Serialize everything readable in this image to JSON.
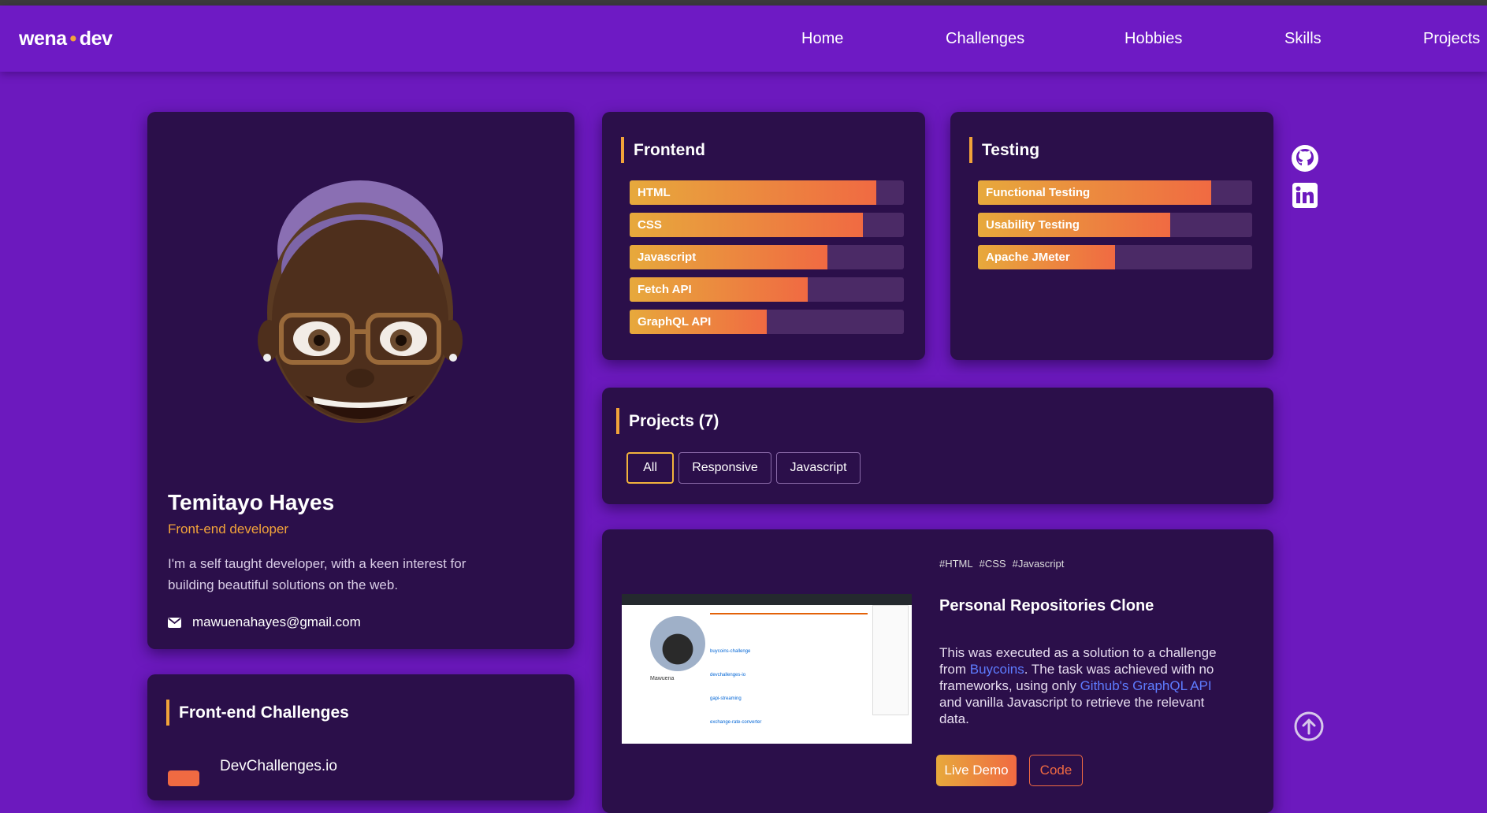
{
  "nav": {
    "brand_left": "wena",
    "brand_dot": "•",
    "brand_right": "dev",
    "links": [
      "Home",
      "Challenges",
      "Hobbies",
      "Skills",
      "Projects"
    ]
  },
  "profile": {
    "name": "Temitayo Hayes",
    "role": "Front-end developer",
    "bio": "I'm a self taught developer, with a keen interest for building beautiful solutions on the web.",
    "email": "mawuenahayes@gmail.com"
  },
  "frontend": {
    "title": "Frontend",
    "skills": [
      {
        "label": "HTML",
        "level": 0.9
      },
      {
        "label": "CSS",
        "level": 0.85
      },
      {
        "label": "Javascript",
        "level": 0.72
      },
      {
        "label": "Fetch API",
        "level": 0.65
      },
      {
        "label": "GraphQL API",
        "level": 0.5
      }
    ]
  },
  "testing": {
    "title": "Testing",
    "skills": [
      {
        "label": "Functional Testing",
        "level": 0.85
      },
      {
        "label": "Usability Testing",
        "level": 0.7
      },
      {
        "label": "Apache JMeter",
        "level": 0.5
      }
    ]
  },
  "projects": {
    "title": "Projects (7)",
    "filters": [
      "All",
      "Responsive",
      "Javascript"
    ],
    "active_filter": "All"
  },
  "project_card": {
    "tags": [
      "#HTML",
      "#CSS",
      "#Javascript"
    ],
    "title": "Personal Repositories Clone",
    "desc_1": "This was executed as a solution to a challenge from ",
    "link_1": "Buycoins",
    "desc_2": ". The task was achieved with no frameworks, using only ",
    "link_2": "Github's GraphQL API",
    "desc_3": " and vanilla Javascript to retrieve the relevant data.",
    "live_label": "Live Demo",
    "code_label": "Code",
    "screenshot": {
      "username": "Mawuena",
      "repo_items": [
        "buycoins-challenge",
        "devchallenges-io",
        "gapi-streaming",
        "exchange-rate-converter"
      ]
    }
  },
  "challenges": {
    "title": "Front-end Challenges",
    "first_item": "DevChallenges.io"
  },
  "social": {
    "github_icon": "github-icon",
    "linkedin_icon": "linkedin-icon"
  },
  "colors": {
    "background": "#6c19be",
    "card": "#2b0f4a",
    "accent": "#f2a33a",
    "link": "#5e7cff"
  }
}
